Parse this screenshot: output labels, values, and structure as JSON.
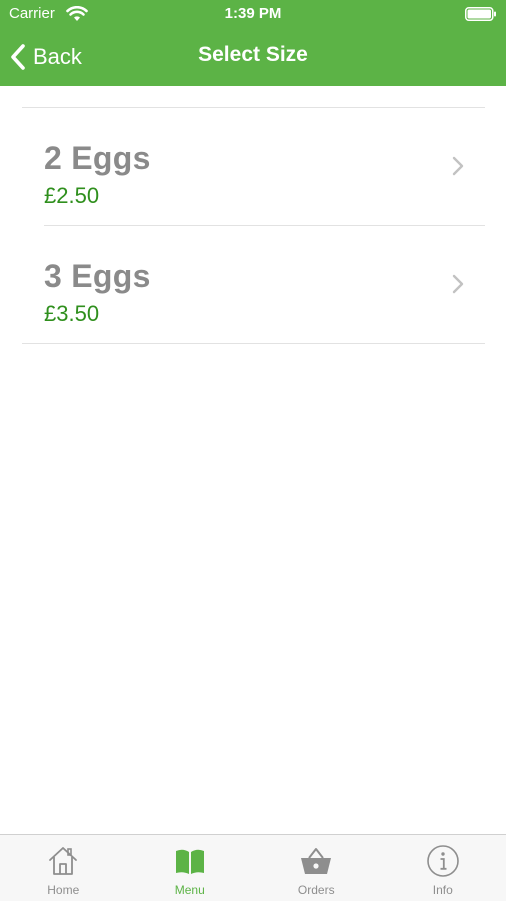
{
  "status_bar": {
    "carrier": "Carrier",
    "time": "1:39 PM"
  },
  "nav": {
    "back_label": "Back",
    "title": "Select Size"
  },
  "items": [
    {
      "title": "2 Eggs",
      "price": "£2.50"
    },
    {
      "title": "3 Eggs",
      "price": "£3.50"
    }
  ],
  "tabs": [
    {
      "label": "Home",
      "icon": "home-icon"
    },
    {
      "label": "Menu",
      "icon": "book-icon",
      "active": true
    },
    {
      "label": "Orders",
      "icon": "basket-icon"
    },
    {
      "label": "Info",
      "icon": "info-icon"
    }
  ],
  "colors": {
    "brand": "#5cb346",
    "price": "#2f8f1d",
    "title": "#8a8a8a"
  }
}
